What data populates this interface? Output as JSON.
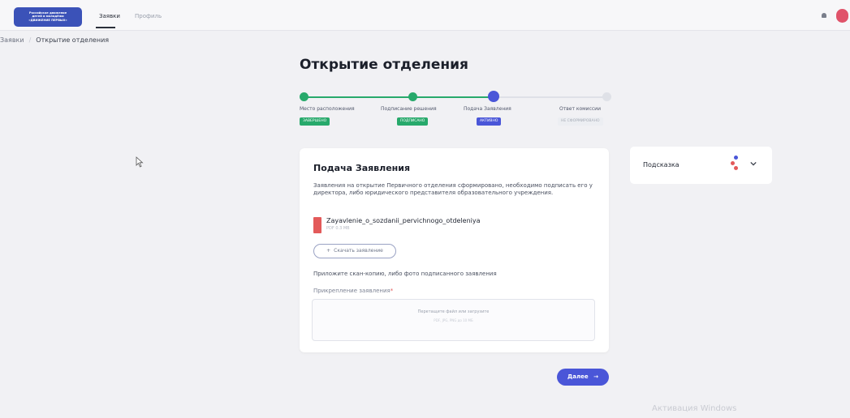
{
  "header": {
    "logo_lines": [
      "Российское движение",
      "детей и молодёжи",
      "«ДВИЖЕНИЕ ПЕРВЫХ»"
    ],
    "tabs": [
      {
        "label": "Заявки",
        "active": true
      },
      {
        "label": "Профиль",
        "active": false
      }
    ]
  },
  "breadcrumb": {
    "items": [
      "Заявки",
      "Открытие отделения"
    ],
    "separator": "/"
  },
  "page": {
    "title": "Открытие отделения"
  },
  "stepper": {
    "steps": [
      {
        "label": "Место расположения",
        "status": "ЗАВЕРШЕНО",
        "state": "done"
      },
      {
        "label": "Подписание решения",
        "status": "ПОДПИСАНО",
        "state": "done"
      },
      {
        "label": "Подача Заявления",
        "status": "АКТИВНО",
        "state": "active"
      },
      {
        "label": "Ответ комиссии",
        "status": "НЕ СФОРМИРОВАНО",
        "state": "pending"
      }
    ],
    "colors": {
      "done": "#27a96b",
      "active": "#4a56d8",
      "pending": "#dfe1e7",
      "pending_text": "#a6abb6"
    }
  },
  "card": {
    "title": "Подача Заявления",
    "description": "Заявления на открытие Первичного отделения сформировано, необходимо подписать его у директора, либо юридического представителя образовательного учреждения.",
    "file": {
      "name": "Zayavlenie_o_sozdanii_pervichnogo_otdeleniya",
      "meta": "PDF 0.3 MB",
      "icon": "pdf-file-icon"
    },
    "download_label": "Скачать заявление",
    "attach_hint": "Приложите скан-копию, либо фото подписанного заявления",
    "attach_label": "Прикрепление заявления",
    "attach_required_mark": "*",
    "dropzone_text": "Перетащите файл или загрузите",
    "dropzone_sub": "PDF, JPG, PNG до 10 МБ"
  },
  "hint": {
    "title": "Подсказка",
    "icon": "chevron-down-icon"
  },
  "actions": {
    "next_label": "Далее",
    "next_arrow": "→"
  },
  "watermark": "Активация Windows",
  "accent_color": "#4a56d8"
}
